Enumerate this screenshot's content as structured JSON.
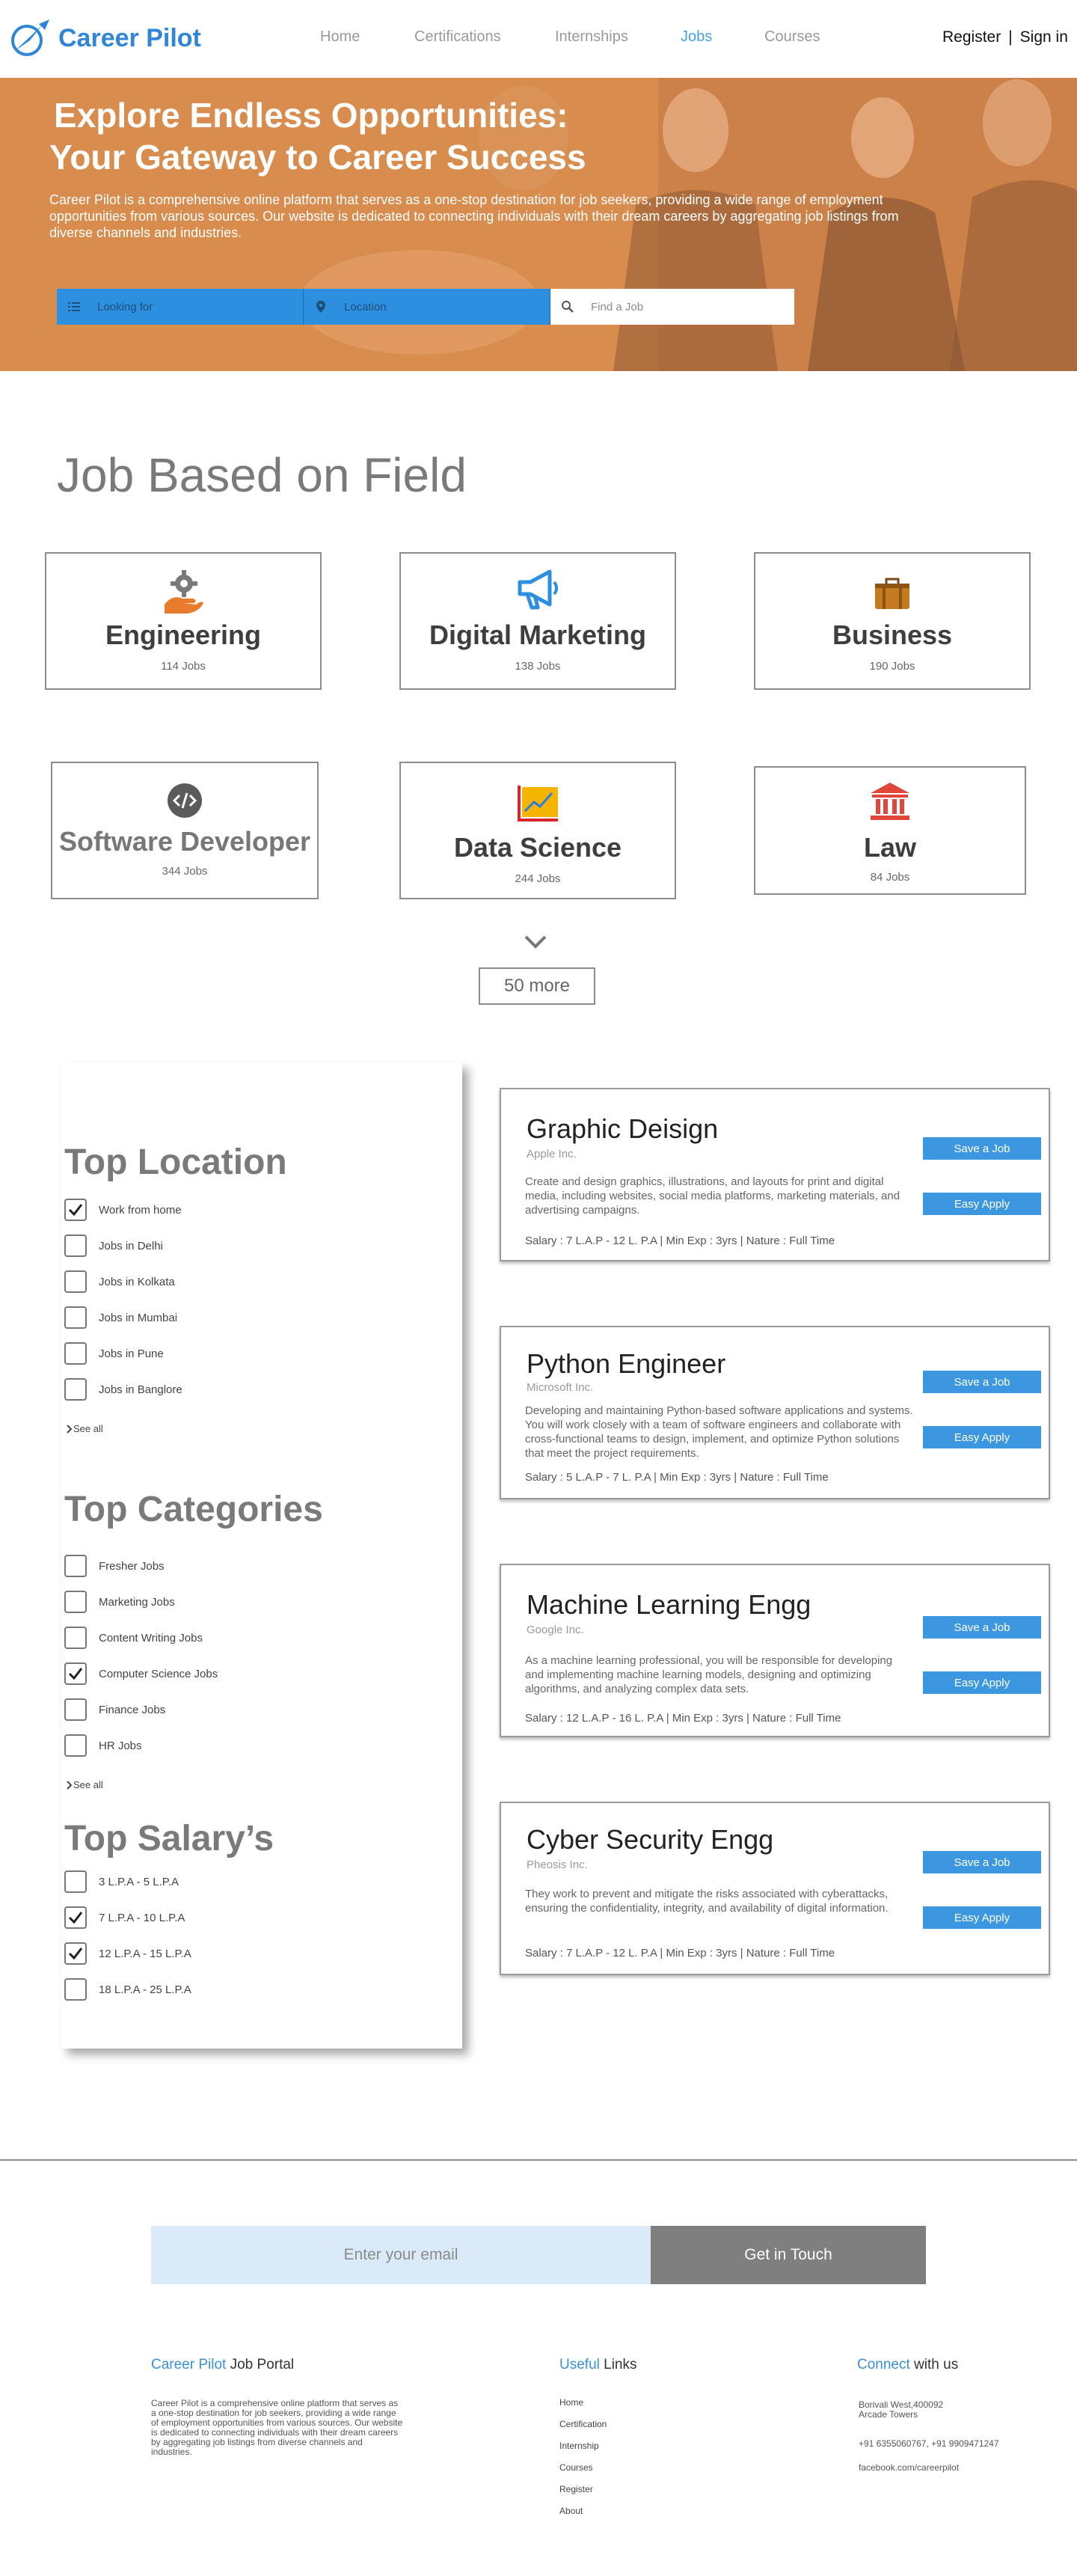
{
  "nav": {
    "brand": "Career Pilot",
    "links": [
      "Home",
      "Certifications",
      "Internships",
      "Jobs",
      "Courses"
    ],
    "register": "Register",
    "separator": "|",
    "signin": "Sign in",
    "active_color": "#4a9fe0"
  },
  "hero": {
    "title_line1": "Explore Endless Opportunities:",
    "title_line2": "Your Gateway to Career Success",
    "description": "Career Pilot is a comprehensive online platform that serves as a one-stop destination for job seekers, providing a wide range of employment opportunities from various sources. Our website is dedicated to connecting individuals with their dream careers by aggregating job listings from diverse channels and industries.",
    "search_looking_for": "Looking for",
    "search_location": "Location",
    "search_find_job": "Find a Job"
  },
  "fields": {
    "title": "Job Based on Field",
    "items": [
      {
        "name": "Engineering",
        "count": "114 Jobs",
        "icon": "gear-hand-icon"
      },
      {
        "name": "Digital Marketing",
        "count": "138 Jobs",
        "icon": "megaphone-icon"
      },
      {
        "name": "Business",
        "count": "190 Jobs",
        "icon": "briefcase-icon"
      },
      {
        "name": "Software Developer",
        "count": "344 Jobs",
        "icon": "code-icon"
      },
      {
        "name": "Data Science",
        "count": "244 Jobs",
        "icon": "chart-icon"
      },
      {
        "name": "Law",
        "count": "84 Jobs",
        "icon": "courthouse-icon"
      }
    ],
    "more": "50 more"
  },
  "filters": {
    "location": {
      "title": "Top Location",
      "options": [
        {
          "label": "Work from home",
          "checked": true
        },
        {
          "label": "Jobs in Delhi",
          "checked": false
        },
        {
          "label": "Jobs in Kolkata",
          "checked": false
        },
        {
          "label": "Jobs in Mumbai",
          "checked": false
        },
        {
          "label": "Jobs in Pune",
          "checked": false
        },
        {
          "label": "Jobs in Banglore",
          "checked": false
        }
      ],
      "see_all": "See all"
    },
    "categories": {
      "title": "Top Categories",
      "options": [
        {
          "label": "Fresher Jobs",
          "checked": false
        },
        {
          "label": "Marketing Jobs",
          "checked": false
        },
        {
          "label": "Content Writing Jobs",
          "checked": false
        },
        {
          "label": "Computer Science Jobs",
          "checked": true
        },
        {
          "label": "Finance Jobs",
          "checked": false
        },
        {
          "label": "HR Jobs",
          "checked": false
        }
      ],
      "see_all": "See all"
    },
    "salary": {
      "title": "Top Salary’s",
      "options": [
        {
          "label": "3 L.P.A - 5 L.P.A",
          "checked": false
        },
        {
          "label": "7 L.P.A - 10 L.P.A",
          "checked": true
        },
        {
          "label": "12 L.P.A - 15 L.P.A",
          "checked": true
        },
        {
          "label": "18 L.P.A - 25 L.P.A",
          "checked": false
        }
      ]
    }
  },
  "jobs": [
    {
      "title": "Graphic Deisign",
      "company": "Apple Inc.",
      "description": "Create and design graphics, illustrations, and layouts for print and digital media, including websites, social media platforms, marketing materials, and advertising campaigns.",
      "meta": "Salary : 7 L.A.P - 12 L. P.A   |  Min Exp : 3yrs  |  Nature : Full Time",
      "save": "Save a Job",
      "apply": "Easy Apply"
    },
    {
      "title": "Python Engineer",
      "company": "Microsoft Inc.",
      "description": " Developing and maintaining Python-based software applications and systems. You will work closely with a team of software engineers and collaborate with cross-functional teams to design, implement, and optimize Python solutions that meet the project requirements.",
      "meta": "Salary : 5 L.A.P - 7 L. P.A   |  Min Exp : 3yrs  |  Nature : Full Time",
      "save": "Save a Job",
      "apply": "Easy Apply"
    },
    {
      "title": "Machine Learning Engg",
      "company": "Google Inc.",
      "description": "As a machine learning professional, you will be responsible for developing and implementing machine learning models, designing and optimizing algorithms, and analyzing complex data sets.",
      "meta": "Salary : 12 L.A.P - 16 L. P.A   |  Min Exp : 3yrs  |  Nature : Full Time",
      "save": "Save a Job",
      "apply": "Easy Apply"
    },
    {
      "title": "Cyber Security Engg",
      "company": "Pheosis Inc.",
      "description": "They work to prevent and mitigate the risks associated with cyberattacks, ensuring the confidentiality, integrity, and availability of digital information.",
      "meta": "Salary : 7 L.A.P - 12 L. P.A   |  Min Exp : 3yrs  |  Nature : Full Time",
      "save": "Save a Job",
      "apply": "Easy Apply"
    }
  ],
  "footer": {
    "email_placeholder": "Enter your email",
    "get_in_touch": "Get in Touch",
    "col1_title_hl": "Career Pilot",
    "col1_title_rest": " Job Portal",
    "col1_text": "Career Pilot is a comprehensive online platform that serves as a one-stop destination for job seekers, providing a wide range of employment opportunities from various sources. Our website is dedicated to connecting individuals with their dream careers by aggregating job listings from diverse channels and industries.",
    "col2_title_hl": "Useful",
    "col2_title_rest": " Links",
    "links": [
      "Home",
      "Certification",
      "Internship",
      "Courses",
      "Register",
      "About"
    ],
    "col3_title_hl": "Connect",
    "col3_title_rest": " with us",
    "address_line1": "Borivali West,400092",
    "address_line2": "Arcade Towers",
    "phones": "+91 6355060767, +91 9909471247",
    "facebook": "facebook.com/careerpilot"
  }
}
